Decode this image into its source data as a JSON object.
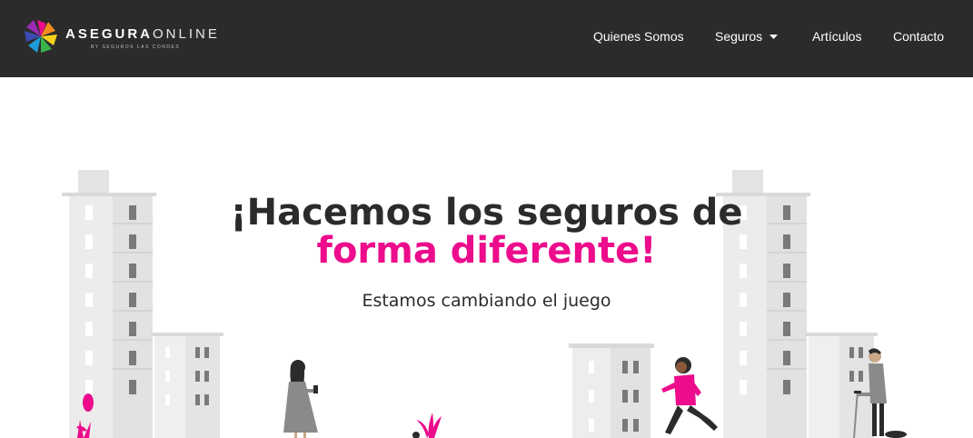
{
  "header": {
    "logo": {
      "brand_bold": "ASEGURA",
      "brand_light": "ONLINE",
      "tagline": "BY SEGUROS LAS CONDES"
    },
    "nav": [
      {
        "label": "Quienes Somos"
      },
      {
        "label": "Seguros",
        "has_dropdown": true
      },
      {
        "label": "Artículos"
      },
      {
        "label": "Contacto"
      }
    ]
  },
  "hero": {
    "title_line1": "¡Hacemos los seguros de",
    "title_line2": "forma diferente!",
    "subtitle": "Estamos cambiando el juego"
  },
  "colors": {
    "header_bg": "#2b2b2b",
    "accent": "#ec0c8c",
    "text_dark": "#2b2b2b",
    "building": "#e6e6e6"
  }
}
